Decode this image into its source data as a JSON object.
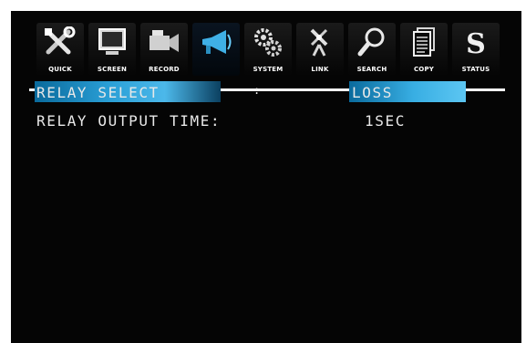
{
  "toolbar": {
    "items": [
      {
        "label": "QUICK",
        "icon": "tools-icon"
      },
      {
        "label": "SCREEN",
        "icon": "monitor-icon"
      },
      {
        "label": "RECORD",
        "icon": "camera-icon"
      },
      {
        "label": "",
        "icon": "megaphone-icon"
      },
      {
        "label": "SYSTEM",
        "icon": "gears-icon"
      },
      {
        "label": "LINK",
        "icon": "antenna-icon"
      },
      {
        "label": "SEARCH",
        "icon": "magnifier-icon"
      },
      {
        "label": "COPY",
        "icon": "documents-icon"
      },
      {
        "label": "STATUS",
        "icon": "status-s-icon"
      }
    ],
    "active_index": 3
  },
  "settings": {
    "relay_select": {
      "label": "RELAY SELECT",
      "separator": ":",
      "value": "LOSS"
    },
    "relay_output_time": {
      "label": "RELAY OUTPUT TIME:",
      "value": "1SEC"
    }
  },
  "colors": {
    "background": "#050505",
    "highlight": "#2a9fd6",
    "text": "#e8e8e8"
  }
}
